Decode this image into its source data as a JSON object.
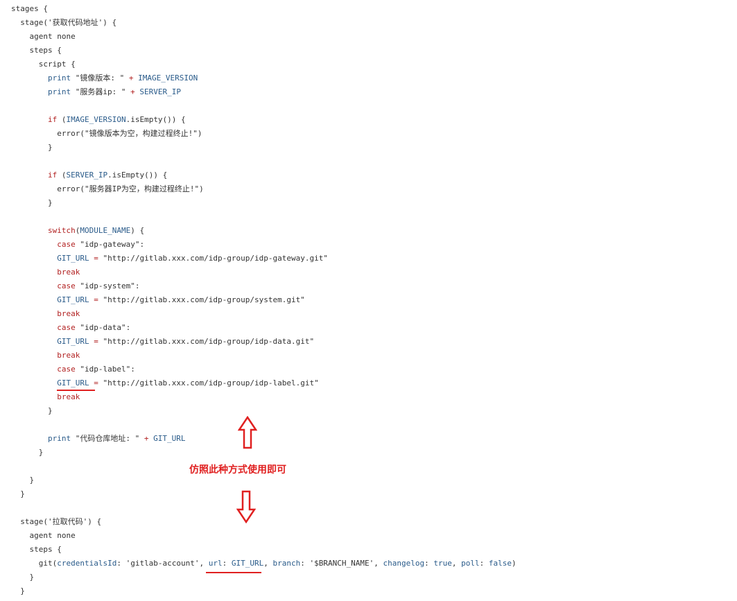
{
  "code_lines": [
    [
      {
        "t": "stages {",
        "c": "plain"
      }
    ],
    [
      {
        "t": "  stage('获取代码地址') {",
        "c": "plain"
      }
    ],
    [
      {
        "t": "    agent none",
        "c": "plain"
      }
    ],
    [
      {
        "t": "    steps {",
        "c": "plain"
      }
    ],
    [
      {
        "t": "      script {",
        "c": "plain"
      }
    ],
    [
      {
        "t": "        ",
        "c": "plain"
      },
      {
        "t": "print",
        "c": "var"
      },
      {
        "t": " \"镜像版本: \" ",
        "c": "str"
      },
      {
        "t": "+",
        "c": "op"
      },
      {
        "t": " IMAGE_VERSION",
        "c": "var"
      }
    ],
    [
      {
        "t": "        ",
        "c": "plain"
      },
      {
        "t": "print",
        "c": "var"
      },
      {
        "t": " \"服务器ip: \" ",
        "c": "str"
      },
      {
        "t": "+",
        "c": "op"
      },
      {
        "t": " SERVER_IP",
        "c": "var"
      }
    ],
    [
      {
        "t": "",
        "c": "plain"
      }
    ],
    [
      {
        "t": "        ",
        "c": "plain"
      },
      {
        "t": "if",
        "c": "kw"
      },
      {
        "t": " (",
        "c": "plain"
      },
      {
        "t": "IMAGE_VERSION",
        "c": "var"
      },
      {
        "t": ".isEmpty()) {",
        "c": "plain"
      }
    ],
    [
      {
        "t": "          error(\"镜像版本为空，构建过程终止!\")",
        "c": "plain"
      }
    ],
    [
      {
        "t": "        }",
        "c": "plain"
      }
    ],
    [
      {
        "t": "",
        "c": "plain"
      }
    ],
    [
      {
        "t": "        ",
        "c": "plain"
      },
      {
        "t": "if",
        "c": "kw"
      },
      {
        "t": " (",
        "c": "plain"
      },
      {
        "t": "SERVER_IP",
        "c": "var"
      },
      {
        "t": ".isEmpty()) {",
        "c": "plain"
      }
    ],
    [
      {
        "t": "          error(\"服务器IP为空，构建过程终止!\")",
        "c": "plain"
      }
    ],
    [
      {
        "t": "        }",
        "c": "plain"
      }
    ],
    [
      {
        "t": "",
        "c": "plain"
      }
    ],
    [
      {
        "t": "        ",
        "c": "plain"
      },
      {
        "t": "switch",
        "c": "kw"
      },
      {
        "t": "(",
        "c": "plain"
      },
      {
        "t": "MODULE_NAME",
        "c": "var"
      },
      {
        "t": ") {",
        "c": "plain"
      }
    ],
    [
      {
        "t": "          ",
        "c": "plain"
      },
      {
        "t": "case",
        "c": "kw"
      },
      {
        "t": " \"idp-gateway\":",
        "c": "str"
      }
    ],
    [
      {
        "t": "          ",
        "c": "plain"
      },
      {
        "t": "GIT_URL",
        "c": "var"
      },
      {
        "t": " = ",
        "c": "op"
      },
      {
        "t": "\"http://gitlab.xxx.com/idp-group/idp-gateway.git\"",
        "c": "str"
      }
    ],
    [
      {
        "t": "          ",
        "c": "plain"
      },
      {
        "t": "break",
        "c": "kw"
      }
    ],
    [
      {
        "t": "          ",
        "c": "plain"
      },
      {
        "t": "case",
        "c": "kw"
      },
      {
        "t": " \"idp-system\":",
        "c": "str"
      }
    ],
    [
      {
        "t": "          ",
        "c": "plain"
      },
      {
        "t": "GIT_URL",
        "c": "var"
      },
      {
        "t": " = ",
        "c": "op"
      },
      {
        "t": "\"http://gitlab.xxx.com/idp-group/system.git\"",
        "c": "str"
      }
    ],
    [
      {
        "t": "          ",
        "c": "plain"
      },
      {
        "t": "break",
        "c": "kw"
      }
    ],
    [
      {
        "t": "          ",
        "c": "plain"
      },
      {
        "t": "case",
        "c": "kw"
      },
      {
        "t": " \"idp-data\":",
        "c": "str"
      }
    ],
    [
      {
        "t": "          ",
        "c": "plain"
      },
      {
        "t": "GIT_URL",
        "c": "var"
      },
      {
        "t": " = ",
        "c": "op"
      },
      {
        "t": "\"http://gitlab.xxx.com/idp-group/idp-data.git\"",
        "c": "str"
      }
    ],
    [
      {
        "t": "          ",
        "c": "plain"
      },
      {
        "t": "break",
        "c": "kw"
      }
    ],
    [
      {
        "t": "          ",
        "c": "plain"
      },
      {
        "t": "case",
        "c": "kw"
      },
      {
        "t": " \"idp-label\":",
        "c": "str"
      }
    ],
    [
      {
        "t": "          ",
        "c": "plain"
      },
      {
        "t": "GIT_URL",
        "c": "var"
      },
      {
        "t": " = ",
        "c": "op"
      },
      {
        "t": "\"http://gitlab.xxx.com/idp-group/idp-label.git\"",
        "c": "str"
      }
    ],
    [
      {
        "t": "          ",
        "c": "plain"
      },
      {
        "t": "break",
        "c": "kw"
      }
    ],
    [
      {
        "t": "        }",
        "c": "plain"
      }
    ],
    [
      {
        "t": "",
        "c": "plain"
      }
    ],
    [
      {
        "t": "        ",
        "c": "plain"
      },
      {
        "t": "print",
        "c": "var"
      },
      {
        "t": " \"代码仓库地址: \" ",
        "c": "str"
      },
      {
        "t": "+",
        "c": "op"
      },
      {
        "t": " GIT_URL",
        "c": "var"
      }
    ],
    [
      {
        "t": "      }",
        "c": "plain"
      }
    ],
    [
      {
        "t": "",
        "c": "plain"
      }
    ],
    [
      {
        "t": "    }",
        "c": "plain"
      }
    ],
    [
      {
        "t": "  }",
        "c": "plain"
      }
    ],
    [
      {
        "t": "",
        "c": "plain"
      }
    ],
    [
      {
        "t": "  stage('拉取代码') {",
        "c": "plain"
      }
    ],
    [
      {
        "t": "    agent none",
        "c": "plain"
      }
    ],
    [
      {
        "t": "    steps {",
        "c": "plain"
      }
    ],
    [
      {
        "t": "      git(",
        "c": "plain"
      },
      {
        "t": "credentialsId",
        "c": "var"
      },
      {
        "t": ": 'gitlab-account', ",
        "c": "plain"
      },
      {
        "t": "url",
        "c": "var"
      },
      {
        "t": ": ",
        "c": "plain"
      },
      {
        "t": "GIT_URL",
        "c": "var"
      },
      {
        "t": ", ",
        "c": "plain"
      },
      {
        "t": "branch",
        "c": "var"
      },
      {
        "t": ": '$BRANCH_NAME', ",
        "c": "plain"
      },
      {
        "t": "changelog",
        "c": "var"
      },
      {
        "t": ": ",
        "c": "plain"
      },
      {
        "t": "true",
        "c": "bool"
      },
      {
        "t": ", ",
        "c": "plain"
      },
      {
        "t": "poll",
        "c": "var"
      },
      {
        "t": ": ",
        "c": "plain"
      },
      {
        "t": "false",
        "c": "bool"
      },
      {
        "t": ")",
        "c": "plain"
      }
    ],
    [
      {
        "t": "    }",
        "c": "plain"
      }
    ],
    [
      {
        "t": "  }",
        "c": "plain"
      }
    ]
  ],
  "annotation": {
    "note_text": "仿照此种方式使用即可",
    "color": "#e02020"
  }
}
